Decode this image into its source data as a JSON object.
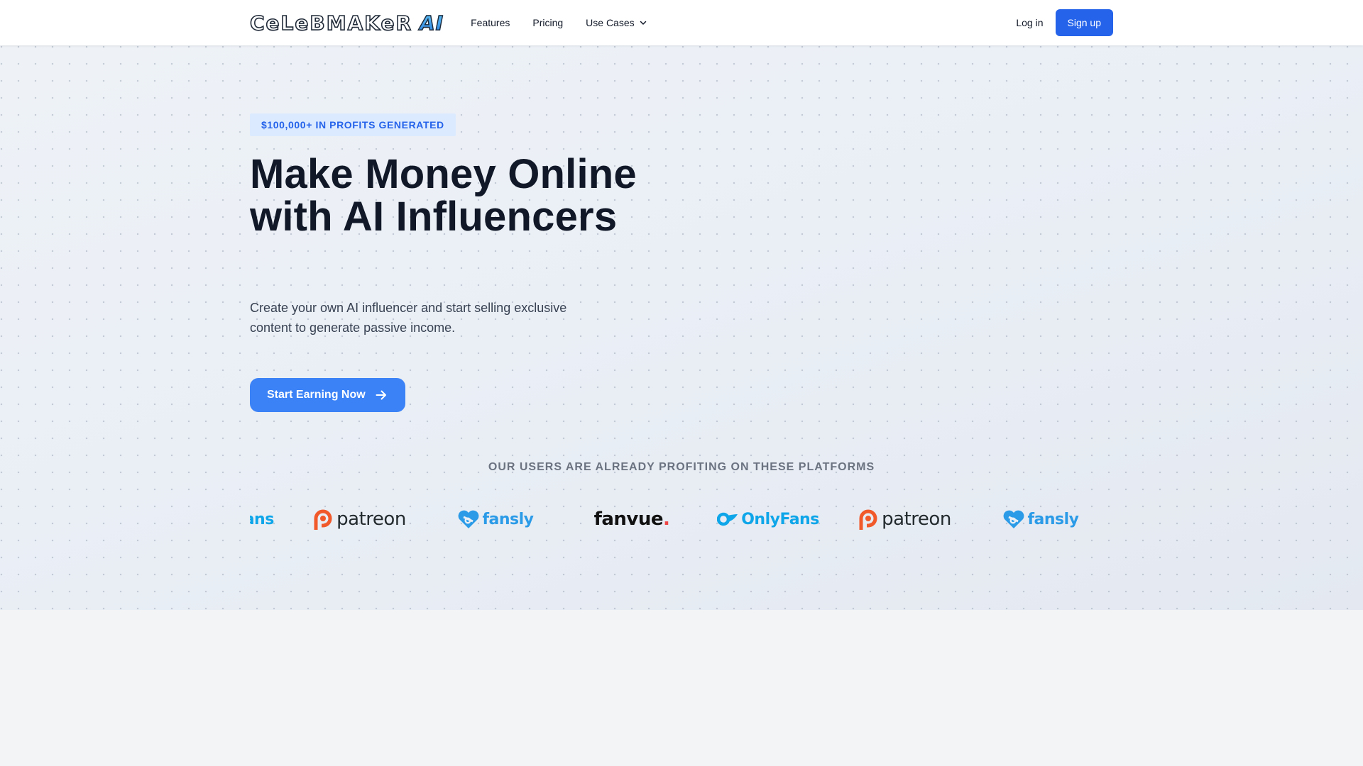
{
  "header": {
    "logo_main": "CeLeBMAKeR",
    "logo_ai": "AI",
    "nav": [
      {
        "label": "Features"
      },
      {
        "label": "Pricing"
      },
      {
        "label": "Use Cases",
        "icon": "chevron-down-icon"
      }
    ],
    "login_label": "Log in",
    "signup_label": "Sign up"
  },
  "hero": {
    "badge": "$100,000+ IN PROFITS GENERATED",
    "title": "Make Money Online with AI Influencers",
    "subtitle": "Create your own AI influencer and start selling exclusive content to generate passive income.",
    "cta_label": "Start Earning Now",
    "cta_icon": "arrow-right-icon",
    "platforms_label": "OUR USERS ARE ALREADY PROFITING ON THESE PLATFORMS",
    "platforms": [
      {
        "name": "OnlyFans",
        "text": "OnlyFans"
      },
      {
        "name": "Patreon",
        "text": "patreon"
      },
      {
        "name": "Fansly",
        "text": "fansly"
      },
      {
        "name": "Fanvue",
        "text": "fanvue",
        "dot": "."
      },
      {
        "name": "OnlyFans",
        "text": "OnlyFans"
      },
      {
        "name": "Patreon",
        "text": "patreon"
      },
      {
        "name": "Fansly",
        "text": "fansly"
      }
    ]
  },
  "colors": {
    "primary": "#2563eb",
    "cta": "#3b82f6",
    "badge_bg": "#dbeafe",
    "heading": "#111827",
    "onlyfans": "#0ea5e9",
    "patreon": "#f1592a",
    "fansly": "#2b9be8",
    "fanvue_dot": "#ef4444"
  }
}
